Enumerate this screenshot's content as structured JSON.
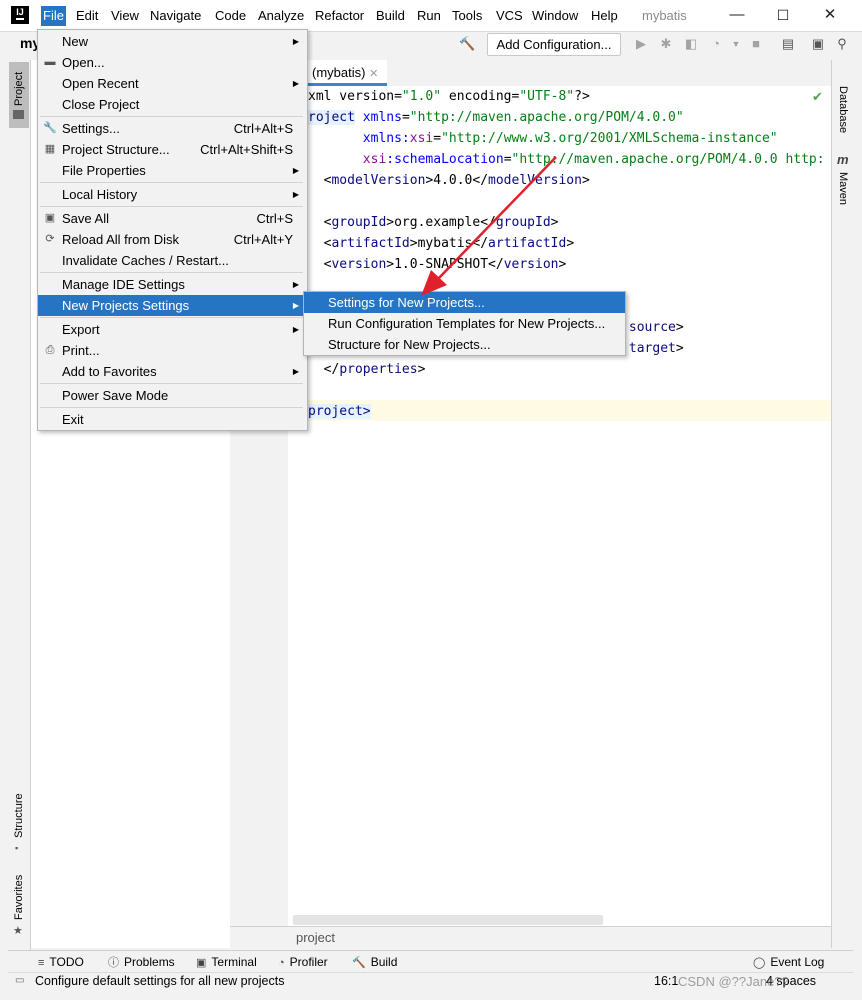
{
  "app_logo": "IJ",
  "menubar": {
    "items": [
      "File",
      "Edit",
      "View",
      "Navigate",
      "Code",
      "Analyze",
      "Refactor",
      "Build",
      "Run",
      "Tools",
      "VCS",
      "Window",
      "Help"
    ],
    "active": "File",
    "project_title": "mybatis"
  },
  "window_controls": {
    "minimize": "—",
    "maximize": "☐",
    "close": "✕"
  },
  "toolbar": {
    "add_configuration": "Add Configuration...",
    "left_fragment": "my"
  },
  "left_strip": {
    "project": "Project",
    "structure": "Structure",
    "favorites": "Favorites"
  },
  "right_strip": {
    "database": "Database",
    "maven": "Maven",
    "maven_icon": "m"
  },
  "editor": {
    "tab_label": "(mybatis)",
    "tab_close": "✕",
    "breadcrumb": "project",
    "check_icon": "✔"
  },
  "code_lines": [
    {
      "parts": [
        [
          "t",
          "xml version="
        ],
        [
          "v",
          "\"1.0\""
        ],
        [
          "t",
          " encoding="
        ],
        [
          "v",
          "\"UTF-8\""
        ],
        [
          "t",
          "?>"
        ]
      ]
    },
    {
      "parts": [
        [
          "hl",
          "roject"
        ],
        [
          "t",
          " "
        ],
        [
          "a",
          "xmlns"
        ],
        [
          "t",
          "="
        ],
        [
          "v",
          "\"http://maven.apache.org/POM/4.0.0\""
        ]
      ]
    },
    {
      "parts": [
        [
          "t",
          "       "
        ],
        [
          "a",
          "xmlns:"
        ],
        [
          "n",
          "xsi"
        ],
        [
          "t",
          "="
        ],
        [
          "v",
          "\"http://www.w3.org/2001/XMLSchema-instance\""
        ]
      ]
    },
    {
      "parts": [
        [
          "t",
          "       "
        ],
        [
          "n",
          "xsi"
        ],
        [
          "a",
          ":schemaLocation"
        ],
        [
          "t",
          "="
        ],
        [
          "v",
          "\"http://maven.apache.org/POM/4.0.0 http:"
        ]
      ]
    },
    {
      "parts": [
        [
          "t",
          "  <"
        ],
        [
          "g",
          "modelVersion"
        ],
        [
          "t",
          ">4.0.0</"
        ],
        [
          "g",
          "modelVersion"
        ],
        [
          "t",
          ">"
        ]
      ]
    },
    {
      "parts": []
    },
    {
      "parts": [
        [
          "t",
          "  <"
        ],
        [
          "g",
          "groupId"
        ],
        [
          "t",
          ">org.example</"
        ],
        [
          "g",
          "groupId"
        ],
        [
          "t",
          ">"
        ]
      ]
    },
    {
      "parts": [
        [
          "t",
          "  <"
        ],
        [
          "g",
          "artifactId"
        ],
        [
          "t",
          ">mybatis</"
        ],
        [
          "g",
          "artifactId"
        ],
        [
          "t",
          ">"
        ]
      ]
    },
    {
      "parts": [
        [
          "t",
          "  <"
        ],
        [
          "g",
          "version"
        ],
        [
          "t",
          ">1.0-SNAPSHOT</"
        ],
        [
          "g",
          "version"
        ],
        [
          "t",
          ">"
        ]
      ]
    },
    {
      "parts": []
    },
    {
      "parts": []
    },
    {
      "parts": [
        [
          "t",
          "                                  "
        ],
        [
          "g",
          "mpiler.source"
        ],
        [
          "t",
          ">"
        ]
      ]
    },
    {
      "parts": [
        [
          "t",
          "                                  "
        ],
        [
          "g",
          "mpiler.target"
        ],
        [
          "t",
          ">"
        ]
      ]
    },
    {
      "parts": [
        [
          "t",
          "  </"
        ],
        [
          "g",
          "properties"
        ],
        [
          "t",
          ">"
        ]
      ]
    },
    {
      "parts": []
    },
    {
      "parts": [
        [
          "hl",
          "project"
        ],
        [
          "hl2",
          ">"
        ]
      ]
    }
  ],
  "file_menu": [
    {
      "label": "New",
      "submenu": true
    },
    {
      "label": "Open...",
      "icon": "folder-icon"
    },
    {
      "label": "Open Recent",
      "submenu": true
    },
    {
      "label": "Close Project"
    },
    {
      "sep": true
    },
    {
      "label": "Settings...",
      "shortcut": "Ctrl+Alt+S",
      "icon": "wrench-icon"
    },
    {
      "label": "Project Structure...",
      "shortcut": "Ctrl+Alt+Shift+S",
      "icon": "structure-icon"
    },
    {
      "label": "File Properties",
      "submenu": true
    },
    {
      "sep": true
    },
    {
      "label": "Local History",
      "submenu": true
    },
    {
      "sep": true
    },
    {
      "label": "Save All",
      "shortcut": "Ctrl+S",
      "icon": "save-icon"
    },
    {
      "label": "Reload All from Disk",
      "shortcut": "Ctrl+Alt+Y",
      "icon": "reload-icon"
    },
    {
      "label": "Invalidate Caches / Restart..."
    },
    {
      "sep": true
    },
    {
      "label": "Manage IDE Settings",
      "submenu": true
    },
    {
      "label": "New Projects Settings",
      "submenu": true,
      "selected": true
    },
    {
      "sep": true
    },
    {
      "label": "Export",
      "submenu": true
    },
    {
      "label": "Print...",
      "icon": "print-icon"
    },
    {
      "label": "Add to Favorites",
      "submenu": true
    },
    {
      "sep": true
    },
    {
      "label": "Power Save Mode"
    },
    {
      "sep": true
    },
    {
      "label": "Exit"
    }
  ],
  "submenu": [
    {
      "label": "Settings for New Projects...",
      "selected": true
    },
    {
      "label": "Run Configuration Templates for New Projects..."
    },
    {
      "label": "Structure for New Projects..."
    }
  ],
  "tool_windows": [
    {
      "label": "TODO",
      "icon": "list-icon"
    },
    {
      "label": "Problems",
      "icon": "info-icon"
    },
    {
      "label": "Terminal",
      "icon": "terminal-icon"
    },
    {
      "label": "Profiler",
      "icon": "profiler-icon"
    },
    {
      "label": "Build",
      "icon": "hammer-icon"
    },
    {
      "label": "Event Log",
      "icon": "event-log-icon"
    }
  ],
  "status": {
    "message": "Configure default settings for all new projects",
    "position": "16:1",
    "indent": "4 spaces",
    "watermark": "CSDN @??Jane??"
  },
  "colors": {
    "accent": "#2675c5",
    "annotation_arrow": "#e0202a"
  }
}
